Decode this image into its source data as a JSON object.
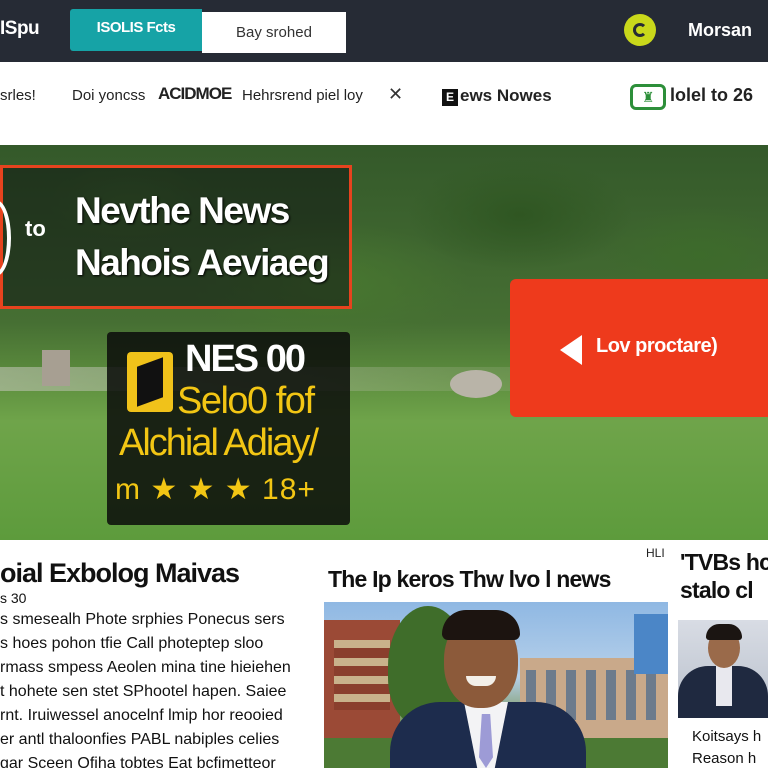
{
  "topbar": {
    "brand": "ISpu",
    "tab_active": "ISOLIS Fcts",
    "tab_search": "Bay srohed",
    "user_name": "Morsan",
    "theme_icon": "crescent-moon-icon",
    "colors": {
      "background": "#262b35",
      "accent": "#16a3a6",
      "theme": "#c9d81b"
    }
  },
  "subnav": {
    "items": [
      "srles!",
      "Doi yoncss",
      "ACIDMOE",
      "Hehrsrend piel loy"
    ],
    "close_glyph": "✕",
    "box_letter": "E",
    "news_label": "ews Nowes",
    "ghost_label": "lolel to 26",
    "active_color": "#e63a1f"
  },
  "hero": {
    "to_label": "to",
    "title": "Nevthe News",
    "subtitle": "Nahois Aeviaeg",
    "promo": {
      "line1": "NES 00",
      "line2": "Selo0 fof",
      "line3": "Alchial Adiay/",
      "line4": "m ★ ★ ★ 18+"
    },
    "cta_label": "Lov proctare)",
    "colors": {
      "cta": "#ee3a1c",
      "promo_text": "#f2c614"
    }
  },
  "articles": [
    {
      "heading": "oial Exbolog Maivas",
      "meta": "s 30",
      "lines": [
        "s smesealh Phote srphies Ponecus sers",
        "s hoes pohon tfie Call photeptep sloo",
        "rmass smpess Aeolen mina tine hieiehen",
        "t hohete sen stet SPhootel hapen. Saiee",
        "rnt. Iruiwessel anocelnf lmip hor reooied",
        "er antl thaloonfies PABL nabiples celies",
        "gar Sceen Ofiha tobtes Eat bcfimetteor"
      ]
    },
    {
      "label": "HLI",
      "heading": "The Ip keros Thw lvo l news"
    },
    {
      "heading_line1": "'TVBs hc",
      "heading_line2": "stalo cl",
      "caption_line1": "Koitsays h",
      "caption_line2": "Reason h"
    }
  ]
}
